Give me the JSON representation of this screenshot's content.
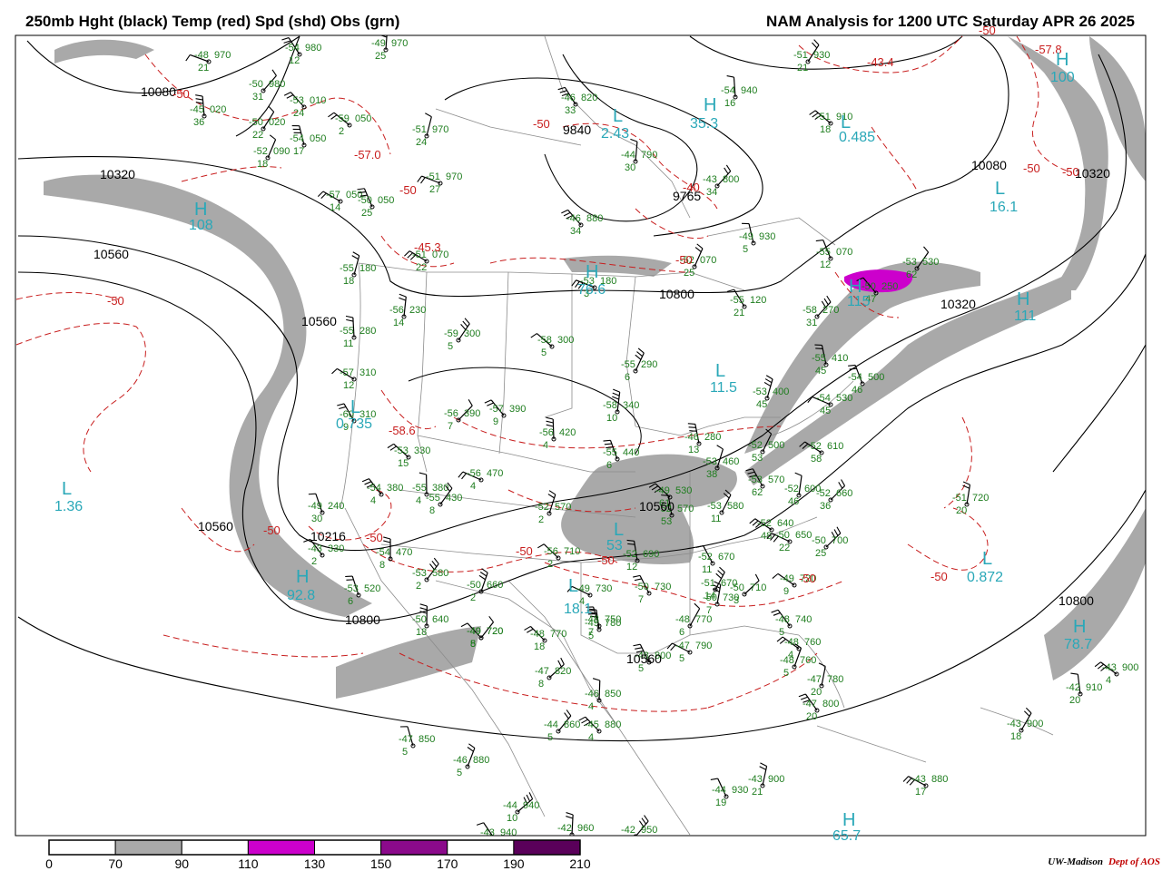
{
  "header": {
    "left_title": "250mb Hght (black) Temp (red) Spd (shd) Obs (grn)",
    "right_title": "NAM Analysis for 1200 UTC Saturday  APR 26 2025"
  },
  "credit": {
    "org": "UW-Madison",
    "dept": "Dept of AOS"
  },
  "colors": {
    "height": "#000000",
    "temp": "#c81e1e",
    "obs": "#1e7d1e",
    "hl": "#2aa8b8",
    "shade70": "#a9a9a9",
    "shade110": "#cc00cc",
    "shade150": "#8b0a8b",
    "shade190": "#5a005a",
    "border": "#8c8c8c"
  },
  "colorbar": {
    "labels": [
      "0",
      "70",
      "90",
      "110",
      "130",
      "150",
      "170",
      "190",
      "210"
    ],
    "segment_colors": [
      "#ffffff",
      "#a9a9a9",
      "#ffffff",
      "#cc00cc",
      "#ffffff",
      "#8b0a8b",
      "#ffffff",
      "#5a005a"
    ]
  },
  "height_labels": [
    "10080",
    "10320",
    "10560",
    "9840",
    "9765",
    "10216",
    "10560",
    "10800",
    "10080",
    "10320",
    "10560",
    "10800",
    "10320",
    "10560",
    "10560",
    "10800"
  ],
  "temp_labels": [
    "-50",
    "-57.0",
    "-50",
    "-45.3",
    "-50",
    "-58.6",
    "-50",
    "-50",
    "-50",
    "-43.4",
    "-57.8",
    "-50",
    "-50",
    "-40",
    "-50",
    "-50",
    "-50",
    "-50",
    "-50",
    "-50"
  ],
  "highs_lows": [
    {
      "letter": "H",
      "value": "108"
    },
    {
      "letter": "H",
      "value": "92.8"
    },
    {
      "letter": "H",
      "value": "76.6"
    },
    {
      "letter": "H",
      "value": "35.3"
    },
    {
      "letter": "H",
      "value": "115"
    },
    {
      "letter": "H",
      "value": "100"
    },
    {
      "letter": "H",
      "value": "78.7"
    },
    {
      "letter": "H",
      "value": "111"
    },
    {
      "letter": "H",
      "value": "65.7"
    },
    {
      "letter": "L",
      "value": "1.36"
    },
    {
      "letter": "L",
      "value": "0.735"
    },
    {
      "letter": "L",
      "value": "2.43"
    },
    {
      "letter": "L",
      "value": "11.5"
    },
    {
      "letter": "L",
      "value": "16.1"
    },
    {
      "letter": "L",
      "value": "0.872"
    },
    {
      "letter": "L",
      "value": "18.1"
    },
    {
      "letter": "L",
      "value": "0.485"
    },
    {
      "letter": "L",
      "value": "53"
    }
  ],
  "observations": [
    {
      "t": "-48",
      "h": "970",
      "d": "21"
    },
    {
      "t": "-54",
      "h": "980",
      "d": "12"
    },
    {
      "t": "-49",
      "h": "970",
      "d": "25"
    },
    {
      "t": "-50",
      "h": "980",
      "d": "31"
    },
    {
      "t": "-53",
      "h": "010",
      "d": "24"
    },
    {
      "t": "-45",
      "h": "020",
      "d": "36"
    },
    {
      "t": "-50",
      "h": "020",
      "d": "22"
    },
    {
      "t": "-59",
      "h": "050",
      "d": "2"
    },
    {
      "t": "-54",
      "h": "050",
      "d": "17"
    },
    {
      "t": "-52",
      "h": "090",
      "d": "18"
    },
    {
      "t": "-57",
      "h": "050",
      "d": "14"
    },
    {
      "t": "-50",
      "h": "050",
      "d": "25"
    },
    {
      "t": "-51",
      "h": "970",
      "d": "24"
    },
    {
      "t": "-51",
      "h": "970",
      "d": "27"
    },
    {
      "t": "-46",
      "h": "820",
      "d": "33"
    },
    {
      "t": "-44",
      "h": "790",
      "d": "30"
    },
    {
      "t": "-43",
      "h": "800",
      "d": "34"
    },
    {
      "t": "-46",
      "h": "880",
      "d": "34"
    },
    {
      "t": "-54",
      "h": "940",
      "d": "16"
    },
    {
      "t": "-51",
      "h": "930",
      "d": "21"
    },
    {
      "t": "-51",
      "h": "910",
      "d": "18"
    },
    {
      "t": "-49",
      "h": "930",
      "d": "5"
    },
    {
      "t": "-52",
      "h": "070",
      "d": "25"
    },
    {
      "t": "-51",
      "h": "070",
      "d": "22"
    },
    {
      "t": "-55",
      "h": "070",
      "d": "12"
    },
    {
      "t": "-55",
      "h": "180",
      "d": "18"
    },
    {
      "t": "-53",
      "h": "180",
      "d": "3"
    },
    {
      "t": "-55",
      "h": "120",
      "d": "21"
    },
    {
      "t": "-56",
      "h": "230",
      "d": "14"
    },
    {
      "t": "-58",
      "h": "270",
      "d": "31"
    },
    {
      "t": "-50",
      "h": "250",
      "d": "47"
    },
    {
      "t": "-55",
      "h": "280",
      "d": "11"
    },
    {
      "t": "-59",
      "h": "300",
      "d": "5"
    },
    {
      "t": "-58",
      "h": "300",
      "d": "5"
    },
    {
      "t": "-55",
      "h": "410",
      "d": "45"
    },
    {
      "t": "-55",
      "h": "290",
      "d": "6"
    },
    {
      "t": "-57",
      "h": "310",
      "d": "12"
    },
    {
      "t": "-54",
      "h": "500",
      "d": "46"
    },
    {
      "t": "-53",
      "h": "400",
      "d": "45"
    },
    {
      "t": "-54",
      "h": "530",
      "d": "45"
    },
    {
      "t": "-60",
      "h": "310",
      "d": "9"
    },
    {
      "t": "-58",
      "h": "340",
      "d": "10"
    },
    {
      "t": "-56",
      "h": "390",
      "d": "7"
    },
    {
      "t": "-57",
      "h": "390",
      "d": "9"
    },
    {
      "t": "-56",
      "h": "420",
      "d": "4"
    },
    {
      "t": "-53",
      "h": "530",
      "d": "62"
    },
    {
      "t": "-53",
      "h": "330",
      "d": "15"
    },
    {
      "t": "-46",
      "h": "280",
      "d": "13"
    },
    {
      "t": "-52",
      "h": "500",
      "d": "53"
    },
    {
      "t": "-52",
      "h": "610",
      "d": "58"
    },
    {
      "t": "-55",
      "h": "440",
      "d": "6"
    },
    {
      "t": "-53",
      "h": "460",
      "d": "38"
    },
    {
      "t": "-56",
      "h": "470",
      "d": "4"
    },
    {
      "t": "-53",
      "h": "570",
      "d": "62"
    },
    {
      "t": "-52",
      "h": "600",
      "d": "46"
    },
    {
      "t": "-52",
      "h": "660",
      "d": "36"
    },
    {
      "t": "-54",
      "h": "380",
      "d": "4"
    },
    {
      "t": "-55",
      "h": "380",
      "d": "4"
    },
    {
      "t": "-55",
      "h": "430",
      "d": "8"
    },
    {
      "t": "-49",
      "h": "530",
      "d": "61"
    },
    {
      "t": "-52",
      "h": "570",
      "d": "53"
    },
    {
      "t": "-53",
      "h": "580",
      "d": "11"
    },
    {
      "t": "-52",
      "h": "640",
      "d": "48"
    },
    {
      "t": "-49",
      "h": "240",
      "d": "30"
    },
    {
      "t": "-52",
      "h": "570",
      "d": "2"
    },
    {
      "t": "-50",
      "h": "650",
      "d": "22"
    },
    {
      "t": "-52",
      "h": "670",
      "d": "11"
    },
    {
      "t": "-51",
      "h": "720",
      "d": "20"
    },
    {
      "t": "-50",
      "h": "700",
      "d": "25"
    },
    {
      "t": "-43",
      "h": "330",
      "d": "2"
    },
    {
      "t": "-54",
      "h": "470",
      "d": "8"
    },
    {
      "t": "-53",
      "h": "580",
      "d": "2"
    },
    {
      "t": "-56",
      "h": "710",
      "d": "2"
    },
    {
      "t": "-52",
      "h": "690",
      "d": "12"
    },
    {
      "t": "-51",
      "h": "670",
      "d": "14"
    },
    {
      "t": "-49",
      "h": "720",
      "d": "9"
    },
    {
      "t": "-53",
      "h": "520",
      "d": "6"
    },
    {
      "t": "-50",
      "h": "660",
      "d": "2"
    },
    {
      "t": "-49",
      "h": "730",
      "d": "4"
    },
    {
      "t": "-50",
      "h": "730",
      "d": "7"
    },
    {
      "t": "-50",
      "h": "730",
      "d": "7"
    },
    {
      "t": "-50",
      "h": "710",
      "d": "3"
    },
    {
      "t": "-48",
      "h": "740",
      "d": "5"
    },
    {
      "t": "-50",
      "h": "640",
      "d": "18"
    },
    {
      "t": "-49",
      "h": "720",
      "d": "8"
    },
    {
      "t": "-48",
      "h": "770",
      "d": "18"
    },
    {
      "t": "-49",
      "h": "780",
      "d": "5"
    },
    {
      "t": "-48",
      "h": "770",
      "d": "6"
    },
    {
      "t": "-48",
      "h": "760",
      "d": "4"
    },
    {
      "t": "-48",
      "h": "750",
      "d": "7"
    },
    {
      "t": "-48",
      "h": "760",
      "d": "5"
    },
    {
      "t": "-47",
      "h": "790",
      "d": "5"
    },
    {
      "t": "-48",
      "h": "800",
      "d": "5"
    },
    {
      "t": "-47",
      "h": "780",
      "d": "20"
    },
    {
      "t": "-47",
      "h": "820",
      "d": "8"
    },
    {
      "t": "-47",
      "h": "800",
      "d": "20"
    },
    {
      "t": "-46",
      "h": "850",
      "d": "4"
    },
    {
      "t": "-44",
      "h": "860",
      "d": "5"
    },
    {
      "t": "-45",
      "h": "880",
      "d": "4"
    },
    {
      "t": "-42",
      "h": "910",
      "d": "20"
    },
    {
      "t": "-43",
      "h": "900",
      "d": "18"
    },
    {
      "t": "-43",
      "h": "900",
      "d": "4"
    },
    {
      "t": "-47",
      "h": "850",
      "d": "5"
    },
    {
      "t": "-46",
      "h": "880",
      "d": "5"
    },
    {
      "t": "-43",
      "h": "880",
      "d": "17"
    },
    {
      "t": "-44",
      "h": "930",
      "d": "19"
    },
    {
      "t": "-43",
      "h": "900",
      "d": "21"
    },
    {
      "t": "-44",
      "h": "940",
      "d": "10"
    },
    {
      "t": "-43",
      "h": "940",
      "d": "4"
    },
    {
      "t": "-42",
      "h": "960",
      "d": "4"
    },
    {
      "t": "-42",
      "h": "950",
      "d": "4"
    },
    {
      "t": "-49",
      "h": "720",
      "d": "5"
    }
  ]
}
